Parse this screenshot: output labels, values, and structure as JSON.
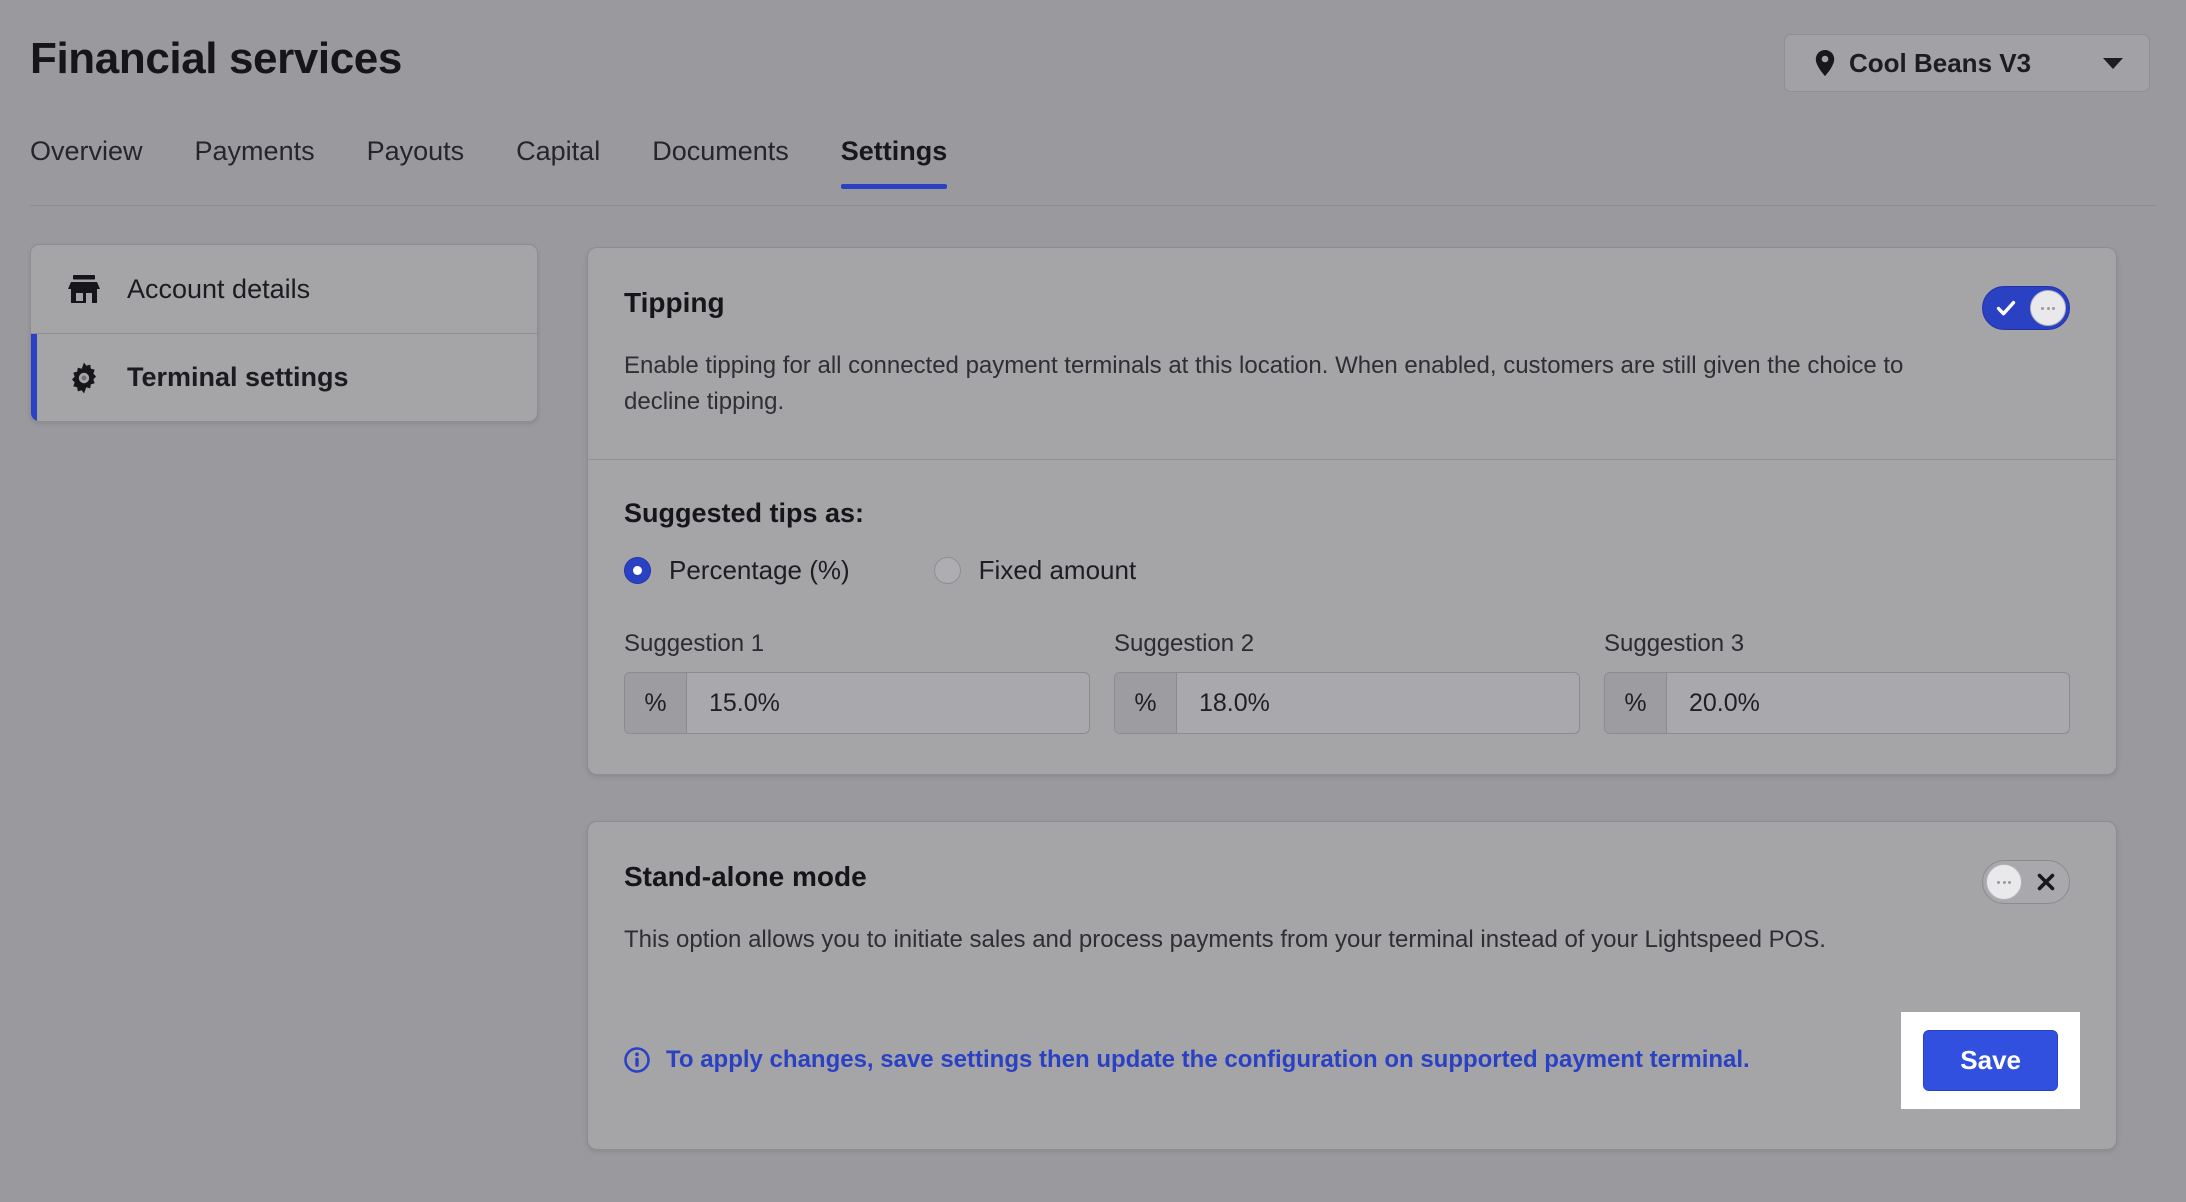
{
  "header": {
    "title": "Financial services",
    "location_selector": {
      "icon": "location-pin-icon",
      "label": "Cool Beans V3",
      "caret": "chevron-down-icon"
    }
  },
  "tabs": [
    {
      "label": "Overview",
      "active": false
    },
    {
      "label": "Payments",
      "active": false
    },
    {
      "label": "Payouts",
      "active": false
    },
    {
      "label": "Capital",
      "active": false
    },
    {
      "label": "Documents",
      "active": false
    },
    {
      "label": "Settings",
      "active": true
    }
  ],
  "sidebar": {
    "items": [
      {
        "label": "Account details",
        "icon": "store-icon",
        "active": false
      },
      {
        "label": "Terminal settings",
        "icon": "gear-icon",
        "active": true
      }
    ]
  },
  "main": {
    "tipping": {
      "title": "Tipping",
      "description": "Enable tipping for all connected payment terminals at this location. When enabled, customers are still given the choice to decline tipping.",
      "toggle": {
        "state": "on",
        "icon": "check-icon"
      }
    },
    "suggested_tips": {
      "title": "Suggested tips as:",
      "options": [
        {
          "label": "Percentage (%)",
          "selected": true
        },
        {
          "label": "Fixed amount",
          "selected": false
        }
      ],
      "fields": [
        {
          "label": "Suggestion 1",
          "addon": "%",
          "value": "15.0%"
        },
        {
          "label": "Suggestion 2",
          "addon": "%",
          "value": "18.0%"
        },
        {
          "label": "Suggestion 3",
          "addon": "%",
          "value": "20.0%"
        }
      ]
    },
    "standalone": {
      "title": "Stand-alone mode",
      "description": "This option allows you to initiate sales and process payments from your terminal instead of your Lightspeed POS.",
      "toggle": {
        "state": "off",
        "icon": "x-icon"
      },
      "notice": {
        "icon": "info-circle-icon",
        "text": "To apply changes, save settings then update the configuration on supported payment terminal."
      },
      "save_label": "Save"
    }
  },
  "colors": {
    "accent_blue": "#2b41c4",
    "save_blue": "#3250e0",
    "page_background": "#9a9a9e",
    "card_background": "#a5a5a8",
    "highlight_box": "#ffffff"
  }
}
